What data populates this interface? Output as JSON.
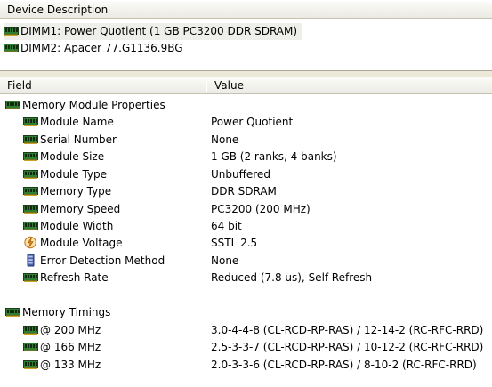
{
  "device_panel": {
    "header": "Device Description",
    "devices": [
      {
        "label": "DIMM1: Power Quotient (1 GB PC3200 DDR SDRAM)",
        "icon": "ram-module-icon",
        "selected": true
      },
      {
        "label": "DIMM2: Apacer 77.G1136.9BG",
        "icon": "ram-module-icon",
        "selected": false
      }
    ]
  },
  "details": {
    "columns": {
      "field": "Field",
      "value": "Value"
    },
    "groups": [
      {
        "title": "Memory Module Properties",
        "icon": "ram-module-icon",
        "rows": [
          {
            "field": "Module Name",
            "value": "Power Quotient",
            "icon": "ram-module-icon"
          },
          {
            "field": "Serial Number",
            "value": "None",
            "icon": "ram-module-icon"
          },
          {
            "field": "Module Size",
            "value": "1 GB (2 ranks, 4 banks)",
            "icon": "ram-module-icon"
          },
          {
            "field": "Module Type",
            "value": "Unbuffered",
            "icon": "ram-module-icon"
          },
          {
            "field": "Memory Type",
            "value": "DDR SDRAM",
            "icon": "ram-module-icon"
          },
          {
            "field": "Memory Speed",
            "value": "PC3200 (200 MHz)",
            "icon": "ram-module-icon"
          },
          {
            "field": "Module Width",
            "value": "64 bit",
            "icon": "ram-module-icon"
          },
          {
            "field": "Module Voltage",
            "value": "SSTL 2.5",
            "icon": "voltage-icon"
          },
          {
            "field": "Error Detection Method",
            "value": "None",
            "icon": "error-detection-icon"
          },
          {
            "field": "Refresh Rate",
            "value": "Reduced (7.8 us), Self-Refresh",
            "icon": "ram-module-icon"
          }
        ]
      },
      {
        "title": "Memory Timings",
        "icon": "ram-module-icon",
        "rows": [
          {
            "field": "@ 200 MHz",
            "value": "3.0-4-4-8  (CL-RCD-RP-RAS) / 12-14-2  (RC-RFC-RRD)",
            "icon": "ram-module-icon"
          },
          {
            "field": "@ 166 MHz",
            "value": "2.5-3-3-7  (CL-RCD-RP-RAS) / 10-12-2  (RC-RFC-RRD)",
            "icon": "ram-module-icon"
          },
          {
            "field": "@ 133 MHz",
            "value": "2.0-3-3-6  (CL-RCD-RP-RAS) / 8-10-2  (RC-RFC-RRD)",
            "icon": "ram-module-icon"
          }
        ]
      }
    ]
  },
  "colors": {
    "ram_icon_green": "#2e7d32",
    "ram_icon_dark": "#1b3d1b",
    "voltage_orange": "#e08a1e",
    "selection": "#eeeeea"
  }
}
